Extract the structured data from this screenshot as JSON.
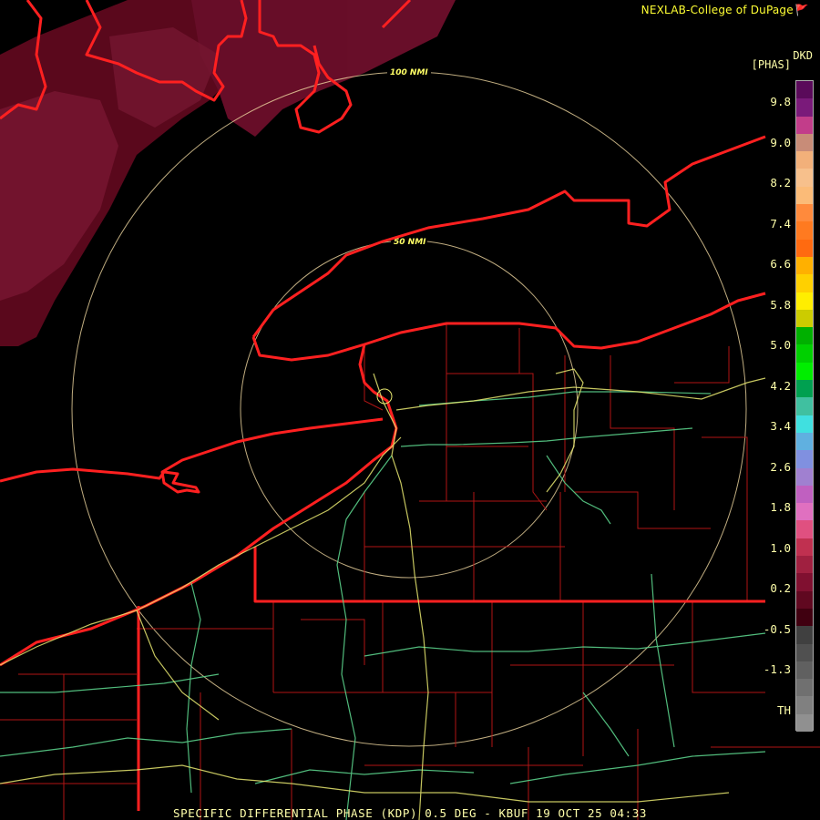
{
  "credit": "NEXLAB-College of DuPage",
  "credit_icon": "flag-icon",
  "footer": "SPECIFIC DIFFERENTIAL PHASE (KDP) 0.5 DEG - KBUF 19 OCT 25 04:33",
  "legend": {
    "product_code": "DKD",
    "unit": "[PHAS]",
    "tick_labels": [
      "9.8",
      "9.0",
      "8.2",
      "7.4",
      "6.6",
      "5.8",
      "5.0",
      "4.2",
      "3.4",
      "2.6",
      "1.8",
      "1.0",
      "0.2",
      "-0.5",
      "-1.3",
      "TH"
    ],
    "colors": [
      "#5a0a5a",
      "#7a1a7a",
      "#c23d8a",
      "#c88c78",
      "#f2b07a",
      "#f7c08c",
      "#fbbb78",
      "#ff8a3c",
      "#ff7a20",
      "#ff6a10",
      "#ffb000",
      "#ffd000",
      "#ffee00",
      "#cccc00",
      "#00b000",
      "#00d000",
      "#00ee00",
      "#00a050",
      "#40c0a0",
      "#40e0e0",
      "#60b0e0",
      "#8090e0",
      "#a080d0",
      "#c060c0",
      "#e070c0",
      "#e05080",
      "#c03050",
      "#a02040",
      "#801030",
      "#600820",
      "#400010",
      "#404040",
      "#505050",
      "#606060",
      "#707070",
      "#808080",
      "#909090"
    ]
  },
  "rings": [
    {
      "label": "100 NMI"
    },
    {
      "label": "50 NMI"
    }
  ],
  "colors": {
    "coast": "#ff2020",
    "county": "#c01818",
    "highway_green": "#5ad08a",
    "highway_yellow": "#e8e870",
    "ring": "#f0d8a0",
    "precip": "#7a0f2a"
  }
}
